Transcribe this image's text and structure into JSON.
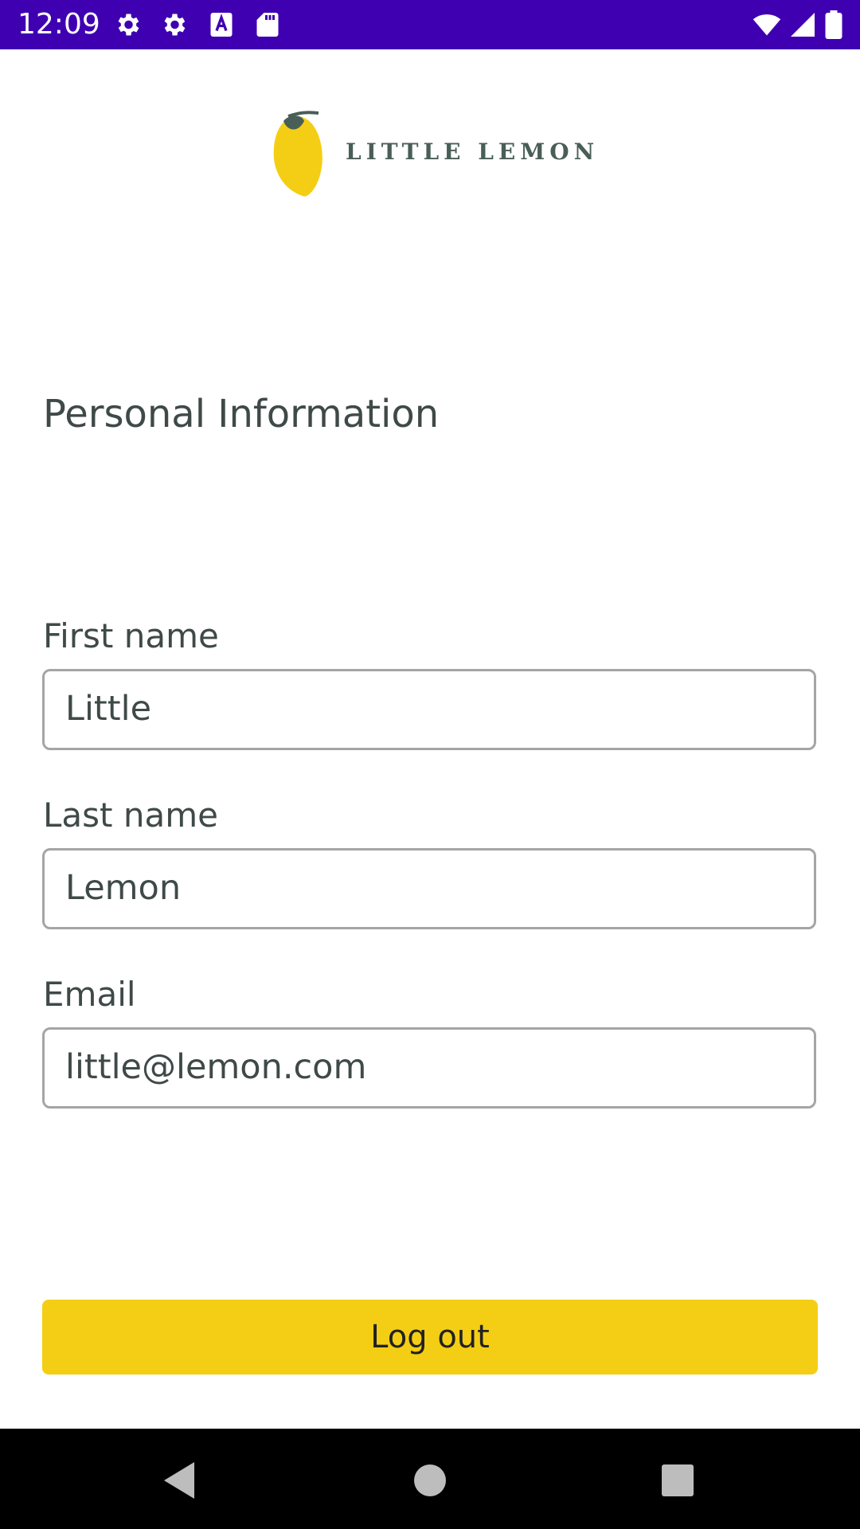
{
  "status_bar": {
    "time": "12:09",
    "icons": [
      "settings-icon",
      "settings-icon",
      "text-a-icon",
      "sd-card-icon",
      "wifi-icon",
      "signal-icon",
      "battery-icon"
    ],
    "background": "#3f00b2"
  },
  "logo": {
    "text": "LITTLE LEMON",
    "icon": "lemon-icon"
  },
  "header": {
    "title": "Personal Information"
  },
  "form": {
    "first_name": {
      "label": "First name",
      "value": "Little"
    },
    "last_name": {
      "label": "Last name",
      "value": "Lemon"
    },
    "email": {
      "label": "Email",
      "value": "little@lemon.com"
    }
  },
  "actions": {
    "logout_label": "Log out",
    "logout_color": "#f4ce14"
  },
  "nav_bar": {
    "icons": [
      "back-icon",
      "home-icon",
      "recents-icon"
    ]
  }
}
